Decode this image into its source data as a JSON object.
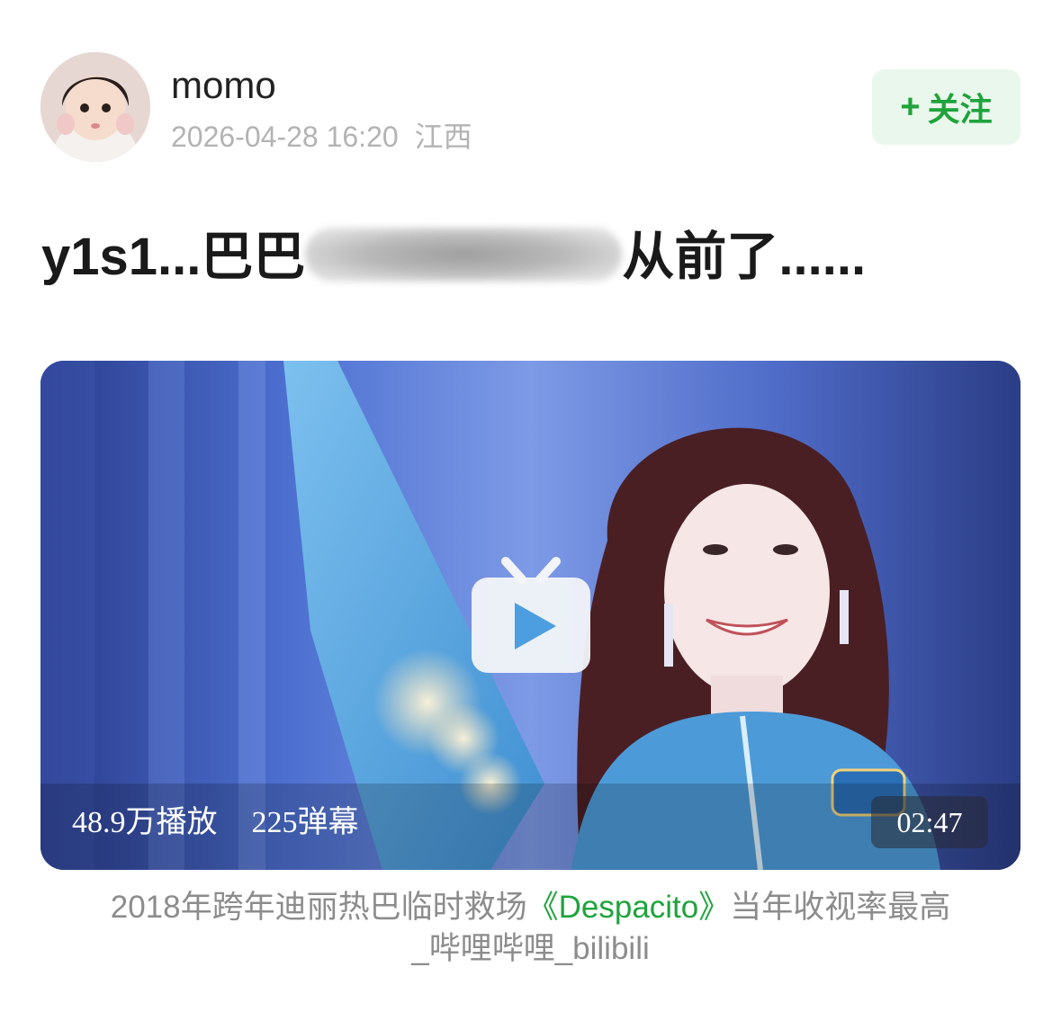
{
  "author": {
    "name": "momo",
    "timestamp": "2026-04-28 16:20",
    "location": "江西",
    "avatar_icon": "avatar-photo"
  },
  "follow_button": {
    "plus": "+",
    "label": "关注"
  },
  "post": {
    "title_prefix": "y1s1...巴巴",
    "title_suffix": "从前了......"
  },
  "video": {
    "play_icon": "bilibili-play-icon",
    "views": "48.9万播放",
    "danmaku": "225弹幕",
    "duration": "02:47",
    "caption_part1": "2018年跨年迪丽热巴临时救场",
    "caption_highlight": "《Despacito》",
    "caption_part2": "当年收视率最高",
    "caption_line2": "_哔哩哔哩_bilibili"
  },
  "colors": {
    "accent_green": "#1fa33c",
    "follow_bg": "#eaf7ec",
    "meta_gray": "#b3b3b3",
    "caption_gray": "#8c8c8c"
  }
}
